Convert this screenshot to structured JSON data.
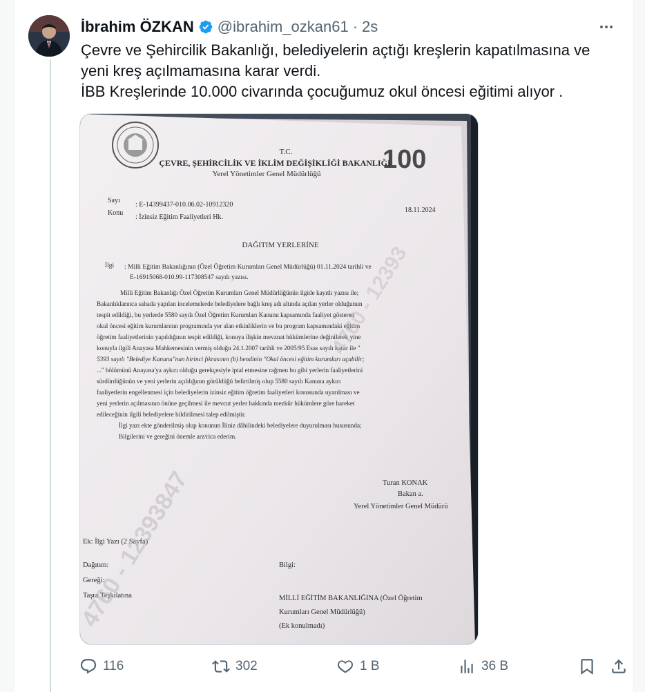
{
  "author": {
    "display_name": "İbrahim ÖZKAN",
    "handle": "@ibrahim_ozkan61",
    "separator": "·",
    "time": "2s"
  },
  "tweet": {
    "lines": [
      "Çevre ve Şehircilik Bakanlığı, belediyelerin açtığı kreşlerin kapatılmasına ve",
      "yeni kreş açılmamasına karar verdi.",
      "İBB Kreşlerinde 10.000 civarında çocuğumuz okul öncesi eğitimi alıyor ."
    ]
  },
  "document": {
    "tc": "T.C.",
    "ministry": "ÇEVRE, ŞEHİRCİLİK VE İKLİM DEĞİŞİKLİĞİ BAKANLIĞI",
    "directorate": "Yerel Yönetimler Genel Müdürlüğü",
    "centenary_logo": "100",
    "sayi_label": "Sayı",
    "sayi_value": ": E-14399437-010.06.02-10912320",
    "date": "18.11.2024",
    "konu_label": "Konu",
    "konu_value": ": İzinsiz Eğitim Faaliyetleri Hk.",
    "heading": "DAĞITIM YERLERİNE",
    "ilgi_label": "İlgi",
    "ilgi_lines": [
      ": Milli Eğitim Bakanlığının (Özel Öğretim Kurumları Genel Müdürlüğü) 01.11.2024 tarihli ve",
      "  E-16915068-010.99-117308547 sayılı yazısı."
    ],
    "body_lines": [
      "Milli Eğitim Bakanlığı Özel Öğretim Kurumları Genel Müdürlüğünün ilgide kayıtlı yazısı ile;",
      "Bakanlıklarınca sahada yapılan incelemelerde belediyelere bağlı kreş adı altında açılan yerler olduğunun",
      "tespit edildiği, bu yerlerde 5580 sayılı Özel Öğretim Kurumları Kanunu kapsamında faaliyet gösteren",
      "okul öncesi eğitim kurumlarının programında yer alan etkinliklerin ve bu program kapsamındaki eğitim",
      "öğretim faaliyetlerinin yapıldığının tespit edildiği, konuya ilişkin mevzuat hükümlerine değinilerek yine",
      "konuyla ilgili Anayasa Mahkemesinin vermiş olduğu 24.1.2007 tarihli ve 2005/95 Esas sayılı karar ile \"",
      "5393 sayılı \"Belediye Kanunu\"nun birinci fıkrasının (b) bendinin \"Okul öncesi eğitim kurumları açabilir;",
      "...\" bölümünü Anayasa'ya aykırı olduğu gerekçesiyle iptal etmesine rağmen bu gibi yerlerin faaliyetlerini",
      "sürdürdüğünün ve yeni yerlerin açıldığının görüldüğü belirtilmiş olup 5580 sayılı Kanuna aykırı",
      "faaliyetlerin engellenmesi için belediyelerin izinsiz eğitim öğretim faaliyetleri konusunda uyarılması ve",
      "yeni yerlerin açılmasının önüne geçilmesi ile mevcut yerler hakkında mezkûr hükümlere göre hareket",
      "edileceğinin ilgili belediyelere bildirilmesi talep edilmiştir.",
      "İlgi yazı ekte gönderilmiş olup konunun İliniz dâhilindeki belediyelere duyurulması hususunda;",
      "Bilgilerini ve gereğini önemle arz/rica ederim."
    ],
    "signer_name": "Turan KONAK",
    "signer_title1": "Bakan a.",
    "signer_title2": "Yerel Yönetimler Genel Müdürü",
    "ek": "Ek:  İlgi Yazı (2 Sayfa)",
    "dagitim": "Dağıtım:",
    "geregi": "Gereği:",
    "tasra": "Taşra Teşkilatına",
    "bilgi": "Bilgi:",
    "bilgi_lines": [
      "MİLLİ EĞİTİM BAKANLIĞINA (Özel Öğretim",
      "Kurumları Genel Müdürlüğü)",
      "(Ek konulmadı)"
    ],
    "watermark": "4760 - 12393847",
    "watermark2": "4760 - 12393"
  },
  "actions": {
    "reply_count": "116",
    "retweet_count": "302",
    "like_count": "1 B",
    "views_count": "36 B"
  },
  "colors": {
    "text_primary": "#0f1419",
    "text_secondary": "#536471",
    "verified": "#1d9bf0"
  },
  "icons": [
    "more-icon",
    "verified-badge-icon",
    "reply-icon",
    "retweet-icon",
    "like-icon",
    "views-icon",
    "bookmark-icon",
    "share-icon"
  ]
}
